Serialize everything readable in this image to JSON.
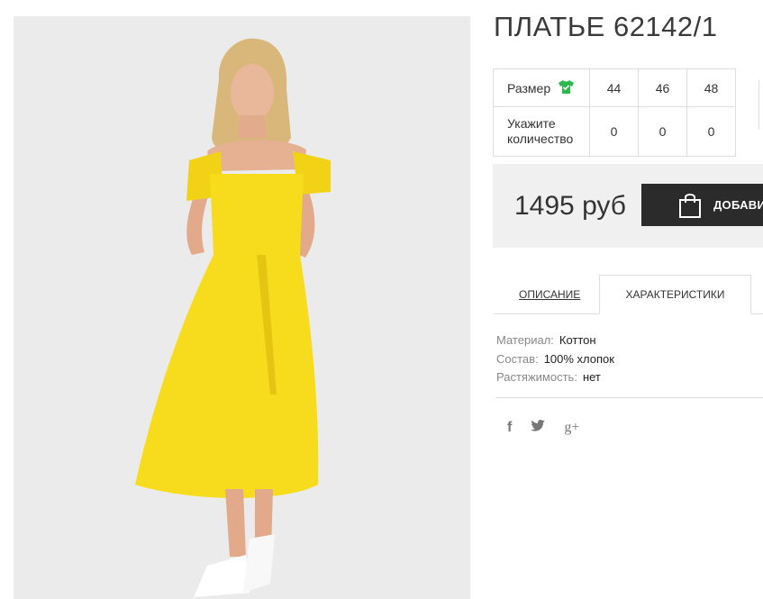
{
  "product": {
    "title": "ПЛАТЬЕ 62142/1",
    "image_alt": "Woman in yellow midi dress"
  },
  "sizes": {
    "size_label": "Размер",
    "size_icon": "shirt-check-icon",
    "size_icon_color": "#2db84b",
    "quantity_label_line1": "Укажите",
    "quantity_label_line2": "количество",
    "options": [
      {
        "size": "44",
        "qty": "0"
      },
      {
        "size": "46",
        "qty": "0"
      },
      {
        "size": "48",
        "qty": "0"
      }
    ]
  },
  "purchase": {
    "price": "1495 руб",
    "add_button": "ДОБАВИТЬ"
  },
  "tabs": [
    {
      "label": "ОПИСАНИЕ",
      "active": false
    },
    {
      "label": "ХАРАКТЕРИСТИКИ",
      "active": true
    }
  ],
  "specs": [
    {
      "key": "Материал:",
      "value": "Коттон"
    },
    {
      "key": "Состав:",
      "value": "100% хлопок"
    },
    {
      "key": "Растяжимость:",
      "value": "нет"
    }
  ],
  "social": {
    "facebook": "f",
    "twitter": "twitter-icon",
    "google_plus": "g+"
  },
  "colors": {
    "dress": "#f7dc1e",
    "button_bg": "#2b2b2b",
    "price_box_bg": "#f0f0f0"
  }
}
